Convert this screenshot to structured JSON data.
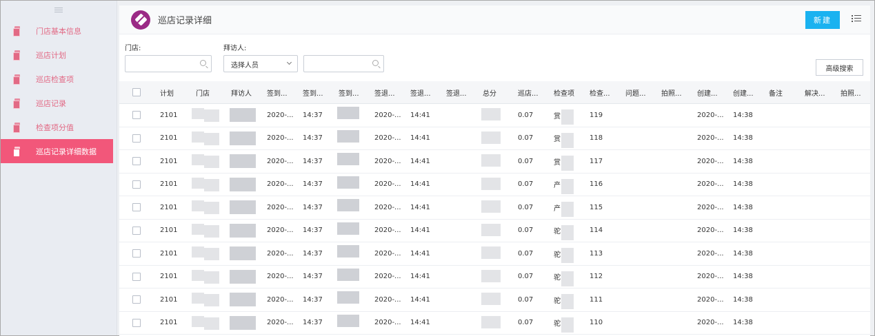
{
  "sidebar": {
    "items": [
      {
        "label": "门店基本信息",
        "active": false
      },
      {
        "label": "巡店计划",
        "active": false
      },
      {
        "label": "巡店检查项",
        "active": false
      },
      {
        "label": "巡店记录",
        "active": false
      },
      {
        "label": "检查项分值",
        "active": false
      },
      {
        "label": "巡店记录详细数据",
        "active": true
      }
    ]
  },
  "header": {
    "title": "巡店记录详细",
    "new_label": "新建"
  },
  "filters": {
    "store_label": "门店:",
    "store_value": "",
    "visitor_label": "拜访人:",
    "visitor_select": "选择人员",
    "visitor_search": "",
    "advanced_label": "高级搜索"
  },
  "table": {
    "columns": [
      "计划",
      "门店",
      "拜访人",
      "签到...",
      "签到...",
      "签到...",
      "签退...",
      "签退...",
      "签退...",
      "总分",
      "巡店...",
      "检查项",
      "检查...",
      "问题...",
      "拍照...",
      "创建...",
      "创建...",
      "备注",
      "解决...",
      "拍照..."
    ],
    "rows": [
      {
        "plan": "2101",
        "signin_date": "2020-...",
        "signin_time": "14:37",
        "signout_date": "2020-...",
        "signout_time": "14:41",
        "ratio": "0.07",
        "item_char": "赏",
        "check_no": "119",
        "created_date": "2020-...",
        "created_time": "14:38"
      },
      {
        "plan": "2101",
        "signin_date": "2020-...",
        "signin_time": "14:37",
        "signout_date": "2020-...",
        "signout_time": "14:41",
        "ratio": "0.07",
        "item_char": "赏",
        "check_no": "118",
        "created_date": "2020-...",
        "created_time": "14:38"
      },
      {
        "plan": "2101",
        "signin_date": "2020-...",
        "signin_time": "14:37",
        "signout_date": "2020-...",
        "signout_time": "14:41",
        "ratio": "0.07",
        "item_char": "赏",
        "check_no": "117",
        "created_date": "2020-...",
        "created_time": "14:38"
      },
      {
        "plan": "2101",
        "signin_date": "2020-...",
        "signin_time": "14:37",
        "signout_date": "2020-...",
        "signout_time": "14:41",
        "ratio": "0.07",
        "item_char": "产",
        "check_no": "116",
        "created_date": "2020-...",
        "created_time": "14:38"
      },
      {
        "plan": "2101",
        "signin_date": "2020-...",
        "signin_time": "14:37",
        "signout_date": "2020-...",
        "signout_time": "14:41",
        "ratio": "0.07",
        "item_char": "产",
        "check_no": "115",
        "created_date": "2020-...",
        "created_time": "14:38"
      },
      {
        "plan": "2101",
        "signin_date": "2020-...",
        "signin_time": "14:37",
        "signout_date": "2020-...",
        "signout_time": "14:41",
        "ratio": "0.07",
        "item_char": "驼",
        "check_no": "114",
        "created_date": "2020-...",
        "created_time": "14:38"
      },
      {
        "plan": "2101",
        "signin_date": "2020-...",
        "signin_time": "14:37",
        "signout_date": "2020-...",
        "signout_time": "14:41",
        "ratio": "0.07",
        "item_char": "驼",
        "check_no": "113",
        "created_date": "2020-...",
        "created_time": "14:38"
      },
      {
        "plan": "2101",
        "signin_date": "2020-...",
        "signin_time": "14:37",
        "signout_date": "2020-...",
        "signout_time": "14:41",
        "ratio": "0.07",
        "item_char": "驼",
        "check_no": "112",
        "created_date": "2020-...",
        "created_time": "14:38"
      },
      {
        "plan": "2101",
        "signin_date": "2020-...",
        "signin_time": "14:37",
        "signout_date": "2020-...",
        "signout_time": "14:41",
        "ratio": "0.07",
        "item_char": "驼",
        "check_no": "111",
        "created_date": "2020-...",
        "created_time": "14:38"
      },
      {
        "plan": "2101",
        "signin_date": "2020-...",
        "signin_time": "14:37",
        "signout_date": "2020-...",
        "signout_time": "14:41",
        "ratio": "0.07",
        "item_char": "驼",
        "check_no": "110",
        "created_date": "2020-...",
        "created_time": "14:38"
      }
    ]
  }
}
